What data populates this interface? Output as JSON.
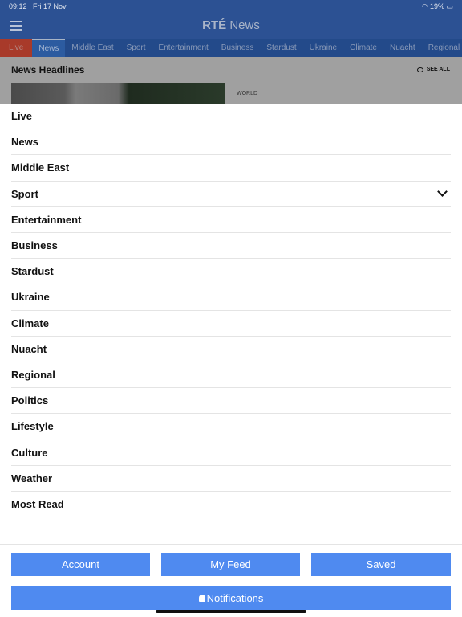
{
  "status": {
    "time": "09:12",
    "date": "Fri 17 Nov",
    "battery": "19%"
  },
  "header": {
    "logo_brand": "RTÉ",
    "logo_section": "News"
  },
  "tabs": [
    "Live",
    "News",
    "Middle East",
    "Sport",
    "Entertainment",
    "Business",
    "Stardust",
    "Ukraine",
    "Climate",
    "Nuacht",
    "Regional"
  ],
  "active_tab": "News",
  "behind": {
    "section_title": "News Headlines",
    "see_all": "SEE ALL",
    "category": "WORLD"
  },
  "menu": [
    "Live",
    "News",
    "Middle East",
    "Sport",
    "Entertainment",
    "Business",
    "Stardust",
    "Ukraine",
    "Climate",
    "Nuacht",
    "Regional",
    "Politics",
    "Lifestyle",
    "Culture",
    "Weather",
    "Most Read"
  ],
  "footer": {
    "account": "Account",
    "my_feed": "My Feed",
    "saved": "Saved",
    "notifications": "Notifications"
  },
  "colors": {
    "header": "#2c5193",
    "button": "#4f8af0",
    "live": "#a83a2a"
  }
}
